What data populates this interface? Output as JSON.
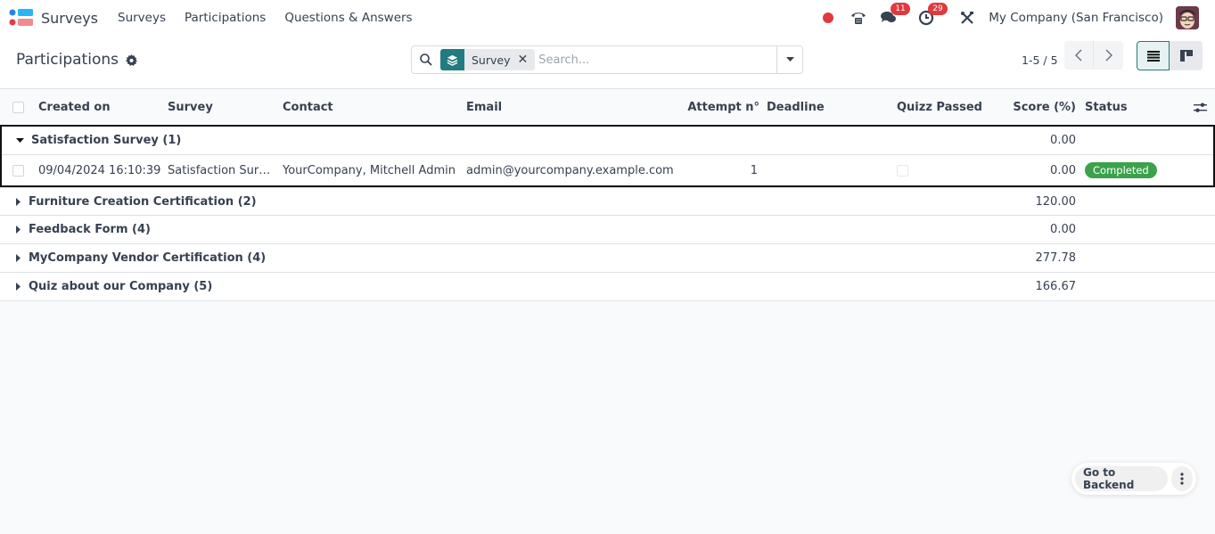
{
  "navbar": {
    "app_name": "Surveys",
    "menu": [
      "Surveys",
      "Participations",
      "Questions & Answers"
    ],
    "messages_badge": "11",
    "activities_badge": "29",
    "company": "My Company (San Francisco)"
  },
  "control_panel": {
    "title": "Participations",
    "search": {
      "facet_label": "Survey",
      "placeholder": "Search..."
    },
    "pager": "1-5 / 5"
  },
  "table": {
    "columns": [
      "Created on",
      "Survey",
      "Contact",
      "Email",
      "Attempt n°",
      "Deadline",
      "Quizz Passed",
      "Score (%)",
      "Status"
    ],
    "groups": [
      {
        "label": "Satisfaction Survey (1)",
        "score": "0.00",
        "expanded": true,
        "records": [
          {
            "created_on": "09/04/2024 16:10:39",
            "survey": "Satisfaction Sur…",
            "contact": "YourCompany, Mitchell Admin",
            "email": "admin@yourcompany.example.com",
            "attempt": "1",
            "deadline": "",
            "quizz_passed": false,
            "score": "0.00",
            "status": "Completed"
          }
        ]
      },
      {
        "label": "Furniture Creation Certification (2)",
        "score": "120.00",
        "expanded": false
      },
      {
        "label": "Feedback Form (4)",
        "score": "0.00",
        "expanded": false
      },
      {
        "label": "MyCompany Vendor Certification (4)",
        "score": "277.78",
        "expanded": false
      },
      {
        "label": "Quiz about our Company (5)",
        "score": "166.67",
        "expanded": false
      }
    ]
  },
  "floating": {
    "backend_label": "Go to Backend"
  },
  "colors": {
    "primary": "#217b80",
    "badge_red": "#e0393e",
    "status_green": "#3ba24b"
  }
}
